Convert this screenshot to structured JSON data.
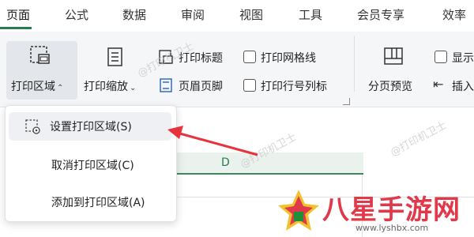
{
  "tabs": [
    "页面",
    "公式",
    "数据",
    "审阅",
    "视图",
    "工具",
    "会员专享",
    "效率"
  ],
  "active_tab": "页面",
  "ribbon": {
    "print_area": "打印区域",
    "print_scale": "打印缩放",
    "print_titles": "打印标题",
    "header_footer": "页眉页脚",
    "print_gridlines": "打印网格线",
    "print_row_col_headers": "打印行号列标",
    "page_break_preview": "分页预览",
    "show": "显示",
    "insert": "插入"
  },
  "menu": {
    "items": [
      "设置打印区域(S)",
      "取消打印区域(C)",
      "添加到打印区域(A)"
    ]
  },
  "sheet": {
    "column_header": "D"
  },
  "watermark": "@打印机卫士",
  "logo": {
    "text": "八星手游网",
    "sub": "www.lyshbx.com"
  },
  "colors": {
    "accent": "#2b7a4b",
    "arrow": "#e8333c",
    "logo": "#e0394a"
  }
}
